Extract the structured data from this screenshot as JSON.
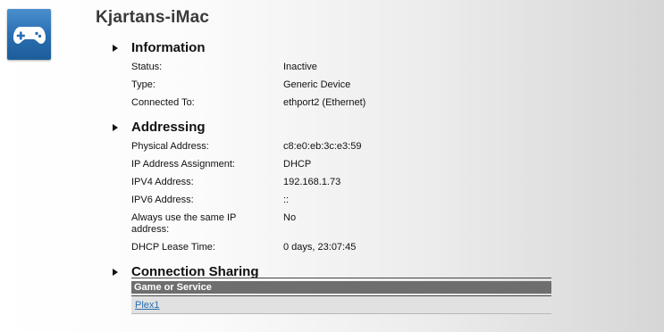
{
  "device": {
    "name": "Kjartans-iMac",
    "icon": "game-controller-icon"
  },
  "sections": {
    "information": {
      "title": "Information",
      "status_label": "Status:",
      "status_value": "Inactive",
      "type_label": "Type:",
      "type_value": "Generic Device",
      "connected_label": "Connected To:",
      "connected_value": "ethport2 (Ethernet)"
    },
    "addressing": {
      "title": "Addressing",
      "physical_label": "Physical Address:",
      "physical_value": "c8:e0:eb:3c:e3:59",
      "assignment_label": "IP Address Assignment:",
      "assignment_value": "DHCP",
      "ipv4_label": "IPV4 Address:",
      "ipv4_value": "192.168.1.73",
      "ipv6_label": "IPV6 Address:",
      "ipv6_value": "::",
      "always_same_label": "Always use the same IP address:",
      "always_same_value": "No",
      "lease_label": "DHCP Lease Time:",
      "lease_value": "0 days, 23:07:45"
    },
    "connection_sharing": {
      "title": "Connection Sharing",
      "column_header": "Game or Service",
      "rows": [
        {
          "name": "Plex1"
        }
      ]
    }
  }
}
